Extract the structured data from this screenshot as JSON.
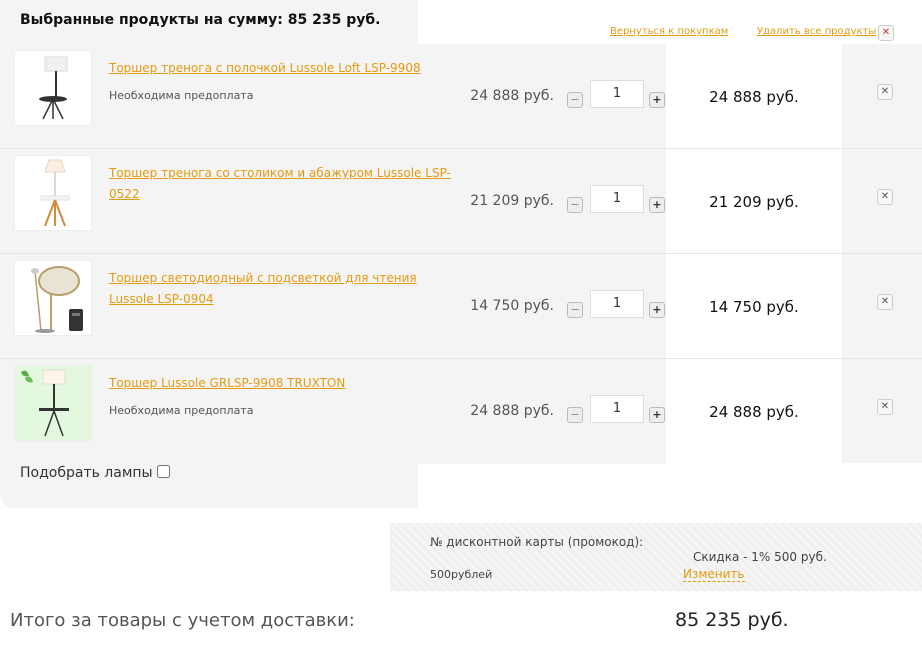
{
  "header": {
    "title_prefix": "Выбранные продукты на сумму:",
    "title_sum": "85 235 руб.",
    "back_link": "Вернуться к покупкам",
    "clear_link": "Удалить все продукты",
    "clear_icon": "close-icon"
  },
  "items": [
    {
      "name": "Торшер тренога с полочкой Lussole Loft LSP-9908",
      "note": "Необходима предоплата",
      "price": "24 888 руб.",
      "qty": "1",
      "total": "24 888 руб.",
      "minus": "−",
      "plus": "+",
      "remove": "✕"
    },
    {
      "name": "Торшер тренога со столиком и абажуром Lussole LSP-0522",
      "note": "",
      "price": "21 209 руб.",
      "qty": "1",
      "total": "21 209 руб.",
      "minus": "−",
      "plus": "+",
      "remove": "✕"
    },
    {
      "name": "Торшер светодиодный с подсветкой для чтения Lussole LSP-0904",
      "note": "",
      "price": "14 750 руб.",
      "qty": "1",
      "total": "14 750 руб.",
      "minus": "−",
      "plus": "+",
      "remove": "✕"
    },
    {
      "name": "Торшер Lussole GRLSP-9908 TRUXTON",
      "note": "Необходима предоплата",
      "price": "24 888 руб.",
      "qty": "1",
      "total": "24 888 руб.",
      "minus": "−",
      "plus": "+",
      "remove": "✕"
    }
  ],
  "pick_lamps": "Подобрать лампы",
  "discount": {
    "label": "№ дисконтной карты (промокод):",
    "sale": "Скидка - 1% 500 руб.",
    "code": "500рублей",
    "change": "Изменить"
  },
  "summary": {
    "label": "Итого за товары с учетом доставки:",
    "value": "85 235 руб."
  },
  "colors": {
    "link": "#e39b12",
    "panel": "#f4f4f4"
  }
}
